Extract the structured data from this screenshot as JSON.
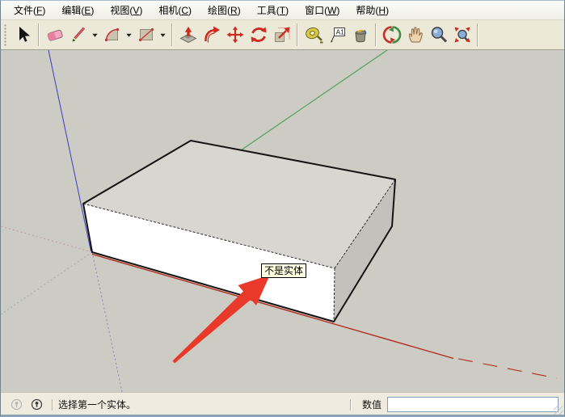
{
  "menu_bar": {
    "items": [
      {
        "label": "文件",
        "mnemonic": "F"
      },
      {
        "label": "编辑",
        "mnemonic": "E"
      },
      {
        "label": "视图",
        "mnemonic": "V"
      },
      {
        "label": "相机",
        "mnemonic": "C"
      },
      {
        "label": "绘图",
        "mnemonic": "R"
      },
      {
        "label": "工具",
        "mnemonic": "T"
      },
      {
        "label": "窗口",
        "mnemonic": "W"
      },
      {
        "label": "帮助",
        "mnemonic": "H"
      }
    ]
  },
  "toolbar": {
    "groups": [
      {
        "tools": [
          {
            "name": "select-tool"
          }
        ]
      },
      {
        "tools": [
          {
            "name": "eraser-tool"
          },
          {
            "name": "line-tool",
            "dropdown": true
          },
          {
            "name": "arc-tool",
            "dropdown": true
          },
          {
            "name": "shape-tool",
            "dropdown": true
          }
        ]
      },
      {
        "tools": [
          {
            "name": "pushpull-tool"
          },
          {
            "name": "followme-tool"
          },
          {
            "name": "move-tool"
          },
          {
            "name": "rotate-tool"
          },
          {
            "name": "scale-tool"
          }
        ]
      },
      {
        "tools": [
          {
            "name": "tape-measure-tool"
          },
          {
            "name": "text-tool",
            "glyph": "A1"
          },
          {
            "name": "paint-bucket-tool"
          }
        ]
      },
      {
        "tools": [
          {
            "name": "orbit-tool"
          },
          {
            "name": "pan-tool"
          },
          {
            "name": "zoom-tool"
          },
          {
            "name": "zoom-extents-tool"
          }
        ]
      }
    ]
  },
  "viewport": {
    "tooltip": "不是实体"
  },
  "status_bar": {
    "icons": [
      {
        "name": "status-help"
      },
      {
        "name": "status-info"
      }
    ],
    "message": "选择第一个实体。",
    "measurement_label": "数值",
    "measurement_value": ""
  },
  "colors": {
    "axis_red": "#b52b20",
    "axis_green": "#55a061",
    "axis_blue": "#3d3dbb",
    "arrow_red": "#e8392b",
    "tooltip_bg": "#ffffe1",
    "face_front": "#ffffff",
    "face_top": "#d7d6d1",
    "face_right": "#c2c1bb",
    "viewport_bg": "#cccbc4"
  }
}
